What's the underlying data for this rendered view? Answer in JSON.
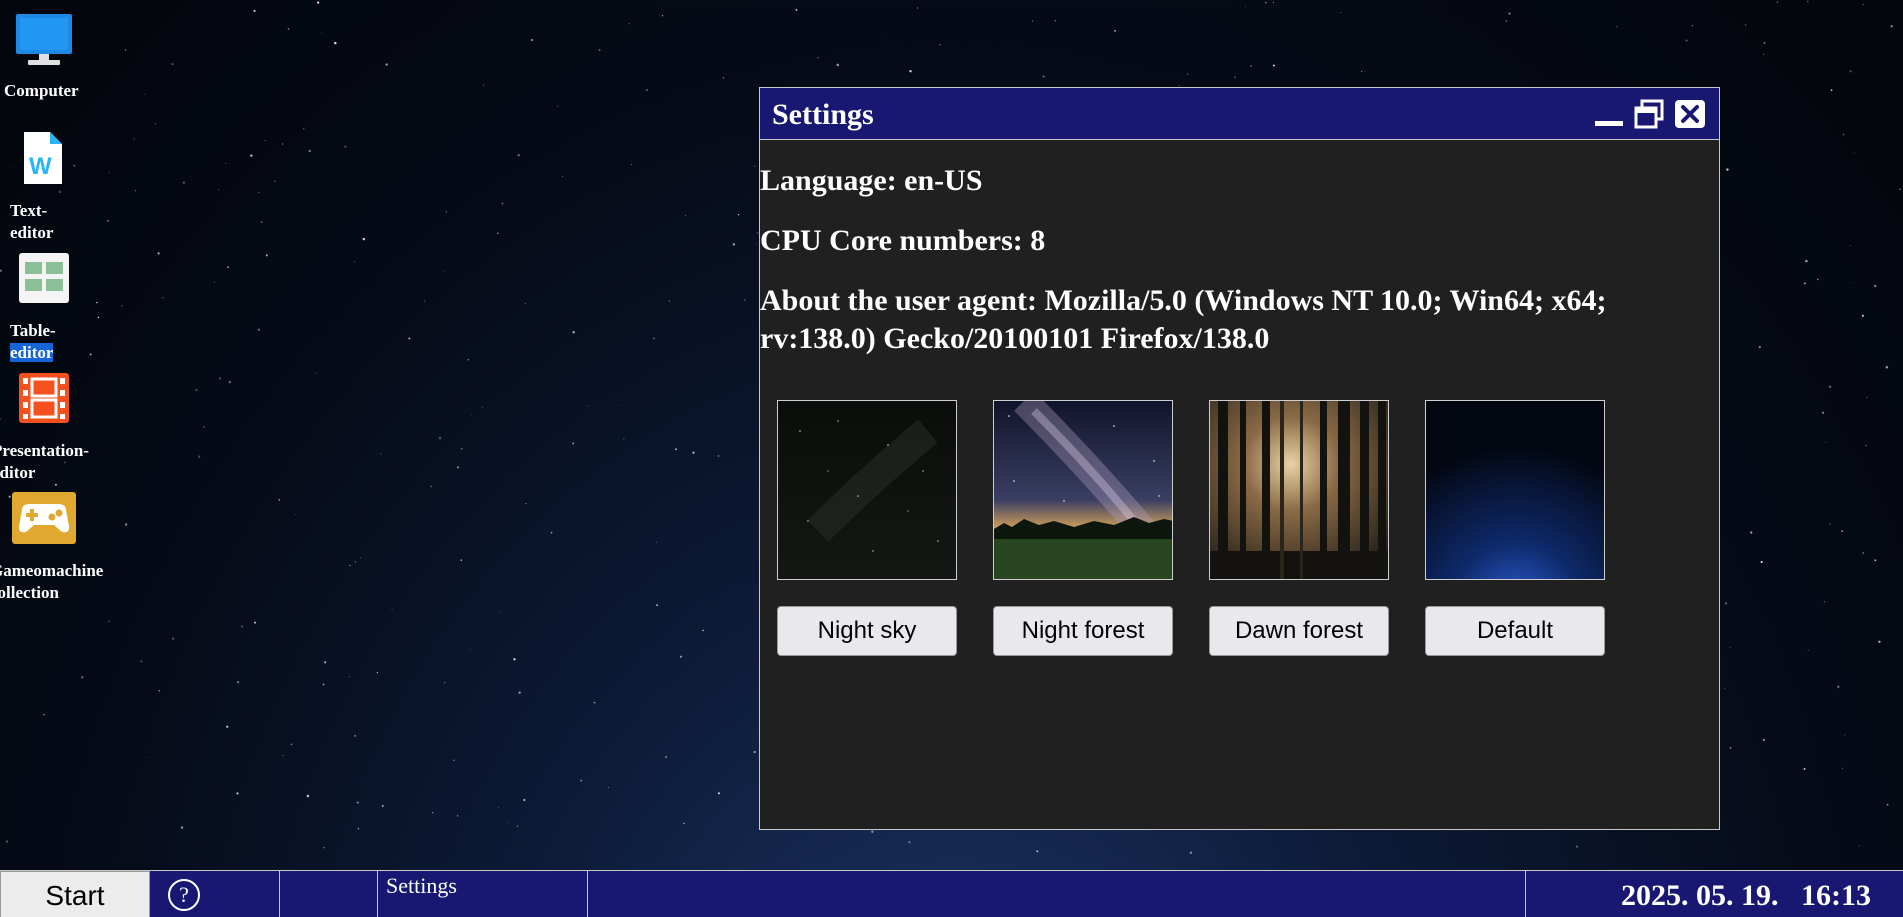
{
  "desktop": {
    "icons": [
      {
        "label_lines": [
          "Computer"
        ],
        "icon": "computer-icon"
      },
      {
        "label_lines": [
          "Text-",
          "editor"
        ],
        "icon": "word-document-icon"
      },
      {
        "label_lines": [
          "Table-",
          "editor"
        ],
        "icon": "spreadsheet-icon"
      },
      {
        "label_lines": [
          "Presentation-",
          "editor"
        ],
        "icon": "film-strip-icon"
      },
      {
        "label_lines": [
          "Gameomachine",
          "collection"
        ],
        "icon": "gamepad-icon"
      }
    ]
  },
  "window": {
    "title": "Settings",
    "controls": [
      "minimize-icon",
      "restore-icon",
      "close-icon"
    ],
    "language_text": "Language: en-US",
    "cpu_text": "CPU Core numbers: 8",
    "user_agent_line1": "About the user agent: Mozilla/5.0 (Windows NT 10.0; Win64; x64;",
    "user_agent_line2": "rv:138.0) Gecko/20100101 Firefox/138.0",
    "wallpapers": [
      {
        "label": "Night sky"
      },
      {
        "label": "Night forest"
      },
      {
        "label": "Dawn forest"
      },
      {
        "label": "Default"
      }
    ]
  },
  "taskbar": {
    "start_label": "Start",
    "help_label": "?",
    "task_label": "Settings",
    "clock": "2025. 05. 19.   16:13"
  },
  "colors": {
    "titlebar": "#181872",
    "taskbar": "#181872",
    "window_bg": "#202020",
    "selection": "#1565d8"
  }
}
